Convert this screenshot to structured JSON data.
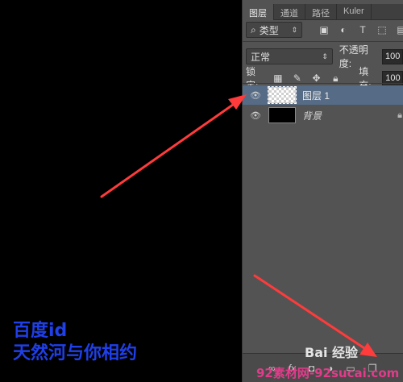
{
  "panel": {
    "tabs": [
      {
        "label": "图层"
      },
      {
        "label": "通道"
      },
      {
        "label": "路径"
      },
      {
        "label": "Kuler"
      }
    ],
    "filter": {
      "kind_label": "类型",
      "search_glyph": "⌕",
      "icons": [
        "image-filter-icon",
        "adjustment-filter-icon",
        "type-filter-icon",
        "shape-filter-icon",
        "smart-object-filter-icon"
      ]
    },
    "blend": {
      "mode": "正常",
      "opacity_label": "不透明度:",
      "opacity_value": "100"
    },
    "lock": {
      "label": "锁定:",
      "fill_label": "填充:",
      "fill_value": "100"
    },
    "layers": [
      {
        "name": "图层 1",
        "selected": true,
        "thumb": "transparent"
      },
      {
        "name": "背景",
        "selected": false,
        "thumb": "black",
        "locked": true
      }
    ],
    "footer_icons": [
      "link-icon",
      "fx-icon",
      "mask-icon",
      "adjustment-icon",
      "folder-icon",
      "new-layer-icon",
      "trash-icon"
    ]
  },
  "canvas": {
    "overlay_line1": "百度id",
    "overlay_line2": "天然河与你相约"
  },
  "watermarks": {
    "baidu": "Bai 经验",
    "site": "92素材网-92sucai.com"
  },
  "colors": {
    "annotation_arrow": "#ff3b3b",
    "overlay_text": "#1f3fe8",
    "selected_layer": "#566b85"
  }
}
